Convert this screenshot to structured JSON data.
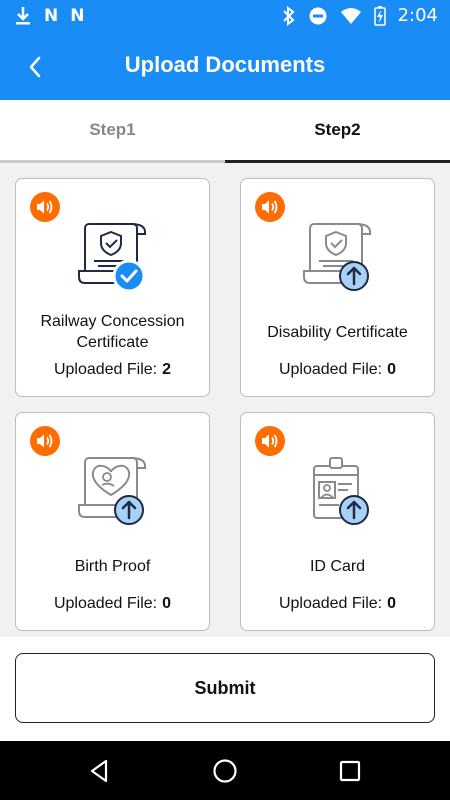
{
  "status_bar": {
    "time": "2:04",
    "left_icons": [
      "download-icon",
      "notification-n-icon",
      "notification-n-icon"
    ],
    "right_icons": [
      "bluetooth-icon",
      "do-not-disturb-icon",
      "wifi-icon",
      "battery-charging-icon"
    ]
  },
  "app_bar": {
    "title": "Upload Documents",
    "back_icon": "chevron-left-icon"
  },
  "tabs": [
    {
      "label": "Step1",
      "selected": false
    },
    {
      "label": "Step2",
      "selected": true
    }
  ],
  "documents": [
    {
      "name": "Railway Concession Certificate",
      "uploaded_label": "Uploaded File:",
      "count": "2",
      "status": "check-badge-icon"
    },
    {
      "name": "Disability Certificate",
      "uploaded_label": "Uploaded File:",
      "count": "0",
      "status": "upload-badge-icon"
    },
    {
      "name": "Birth Proof",
      "uploaded_label": "Uploaded File:",
      "count": "0",
      "status": "upload-badge-icon"
    },
    {
      "name": "ID Card",
      "uploaded_label": "Uploaded File:",
      "count": "0",
      "status": "upload-badge-icon"
    }
  ],
  "submit": {
    "label": "Submit"
  },
  "colors": {
    "primary": "#1a8cf5",
    "accent": "#ff6d00",
    "check": "#1a8cf5",
    "upload_badge": "#a8d1f7"
  },
  "nav": [
    "back-triangle-icon",
    "home-circle-icon",
    "recents-square-icon"
  ]
}
